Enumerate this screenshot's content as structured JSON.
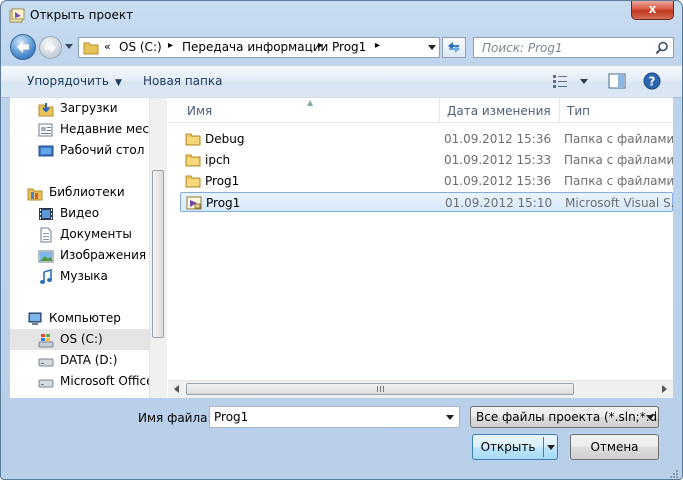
{
  "window": {
    "title": "Открыть проект",
    "close_label": "x"
  },
  "address": {
    "overflow": "«",
    "crumbs": [
      "OS (C:)",
      "Передача информации",
      "Prog1"
    ]
  },
  "search": {
    "placeholder": "Поиск: Prog1"
  },
  "toolbar": {
    "organize_label": "Упорядочить",
    "new_folder_label": "Новая папка"
  },
  "nav": {
    "items": [
      {
        "label": "Загрузки",
        "icon": "downloads-icon"
      },
      {
        "label": "Недавние места",
        "icon": "recent-places-icon"
      },
      {
        "label": "Рабочий стол",
        "icon": "desktop-icon"
      },
      {
        "label": "Библиотеки",
        "icon": "libraries-icon"
      },
      {
        "label": "Видео",
        "icon": "video-icon"
      },
      {
        "label": "Документы",
        "icon": "documents-icon"
      },
      {
        "label": "Изображения",
        "icon": "pictures-icon"
      },
      {
        "label": "Музыка",
        "icon": "music-icon"
      },
      {
        "label": "Компьютер",
        "icon": "computer-icon"
      },
      {
        "label": "OS (C:)",
        "icon": "windows-drive-icon"
      },
      {
        "label": "DATA (D:)",
        "icon": "drive-icon"
      },
      {
        "label": "Microsoft Office",
        "icon": "drive-icon"
      }
    ],
    "selected": "OS (C:)"
  },
  "columns": {
    "name": "Имя",
    "date": "Дата изменения",
    "type": "Тип"
  },
  "files": [
    {
      "name": "Debug",
      "date": "01.09.2012 15:36",
      "type": "Папка с файлами",
      "icon": "folder-icon"
    },
    {
      "name": "ipch",
      "date": "01.09.2012 15:33",
      "type": "Папка с файлами",
      "icon": "folder-icon"
    },
    {
      "name": "Prog1",
      "date": "01.09.2012 15:36",
      "type": "Папка с файлами",
      "icon": "folder-icon"
    },
    {
      "name": "Prog1",
      "date": "01.09.2012 15:10",
      "type": "Microsoft Visual S...",
      "icon": "vs-solution-icon",
      "selected": true
    }
  ],
  "bottom": {
    "filename_label": "Имя файла:",
    "filename_value": "Prog1",
    "filter_value": "Все файлы проекта (*.sln;*.dsw",
    "open_label": "Открыть",
    "cancel_label": "Отмена"
  },
  "colors": {
    "accent": "#3c7fb1",
    "selection": "#d6e8fb",
    "close_red": "#c0381f"
  }
}
